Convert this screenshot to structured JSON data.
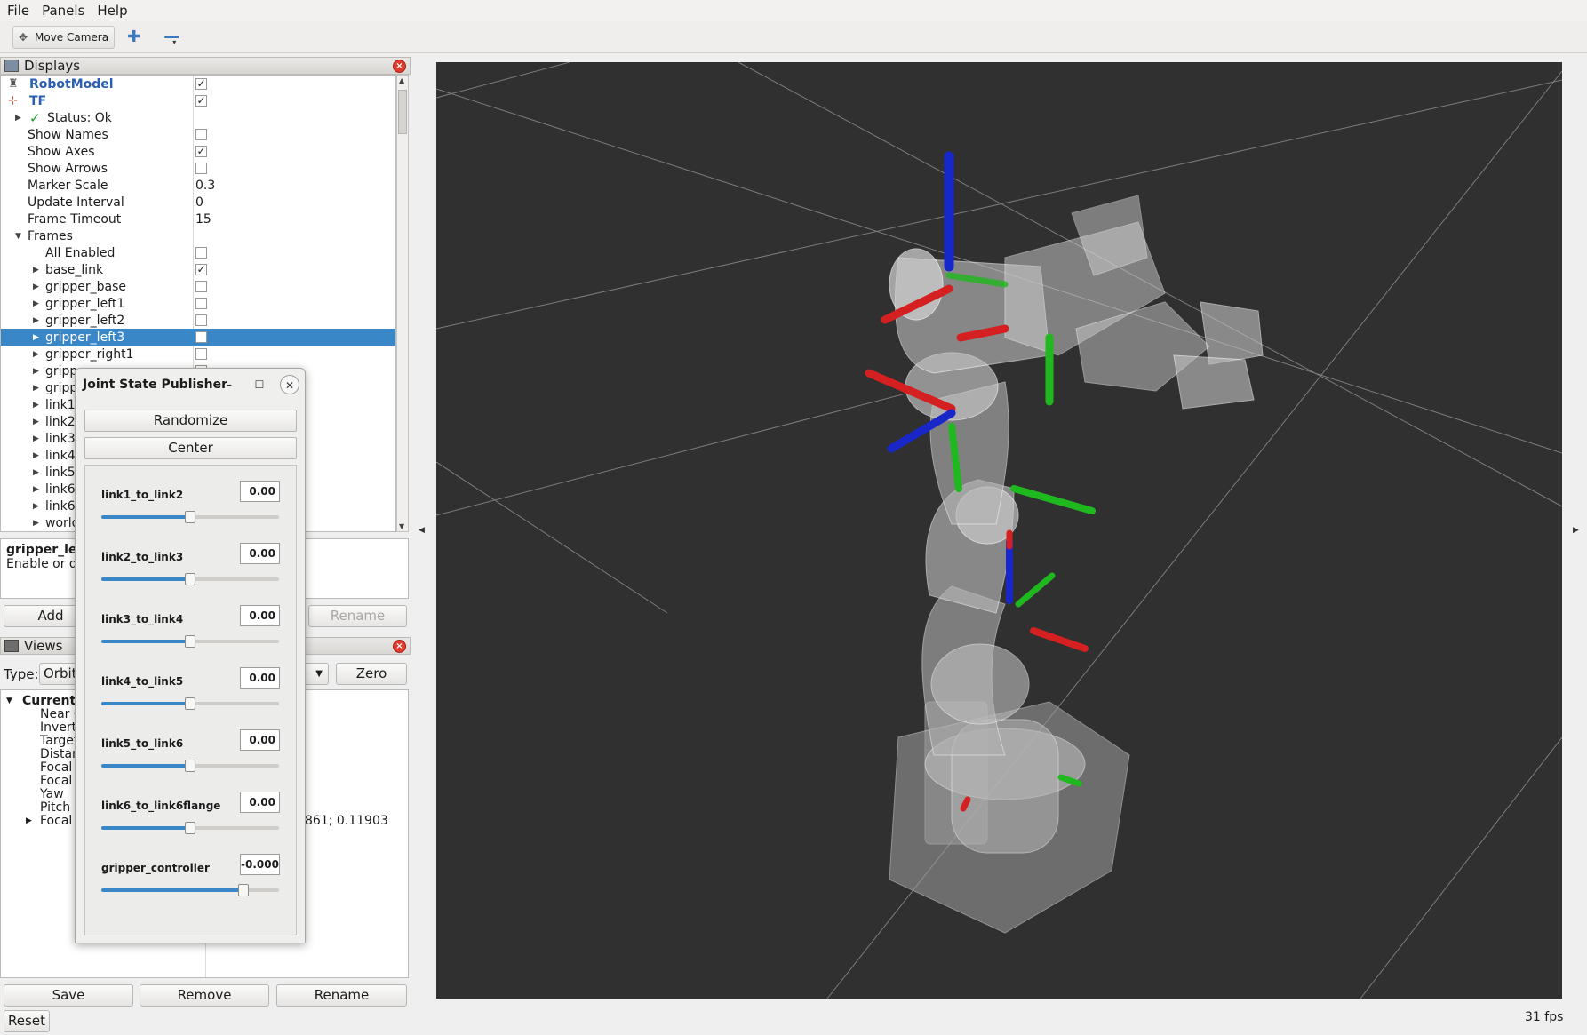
{
  "menu": {
    "file": "File",
    "panels": "Panels",
    "help": "Help"
  },
  "toolbar": {
    "move_camera": "Move Camera"
  },
  "displays_panel": {
    "title": "Displays",
    "tree": [
      {
        "label": "RobotModel",
        "checked": "✓",
        "kind": "display"
      },
      {
        "label": "TF",
        "checked": "✓",
        "kind": "display"
      },
      {
        "label": "Status: Ok",
        "kind": "status"
      },
      {
        "label": "Show Names",
        "checked": ""
      },
      {
        "label": "Show Axes",
        "checked": "✓"
      },
      {
        "label": "Show Arrows",
        "checked": ""
      },
      {
        "label": "Marker Scale",
        "value": "0.3"
      },
      {
        "label": "Update Interval",
        "value": "0"
      },
      {
        "label": "Frame Timeout",
        "value": "15"
      },
      {
        "label": "Frames"
      },
      {
        "label": "All Enabled",
        "checked": ""
      },
      {
        "label": "base_link",
        "checked": "✓"
      },
      {
        "label": "gripper_base",
        "checked": ""
      },
      {
        "label": "gripper_left1",
        "checked": ""
      },
      {
        "label": "gripper_left2",
        "checked": ""
      },
      {
        "label": "gripper_left3",
        "checked": "",
        "selected": true
      },
      {
        "label": "gripper_right1",
        "checked": ""
      },
      {
        "label": "gripp",
        "checked": ""
      },
      {
        "label": "gripp"
      },
      {
        "label": "link1"
      },
      {
        "label": "link2"
      },
      {
        "label": "link3"
      },
      {
        "label": "link4"
      },
      {
        "label": "link5"
      },
      {
        "label": "link6"
      },
      {
        "label": "link6"
      },
      {
        "label": "world"
      }
    ],
    "description_title": "gripper_lef",
    "description_text": "Enable or di",
    "buttons": {
      "add": "Add",
      "rename": "Rename"
    }
  },
  "views_panel": {
    "title": "Views",
    "type_label": "Type:",
    "type_value": "Orbit",
    "zero": "Zero",
    "tree": [
      {
        "label": "Current"
      },
      {
        "label": "Near C"
      },
      {
        "label": "Invert"
      },
      {
        "label": "Target"
      },
      {
        "label": "Distan"
      },
      {
        "label": "Focal"
      },
      {
        "label": "Focal"
      },
      {
        "label": "Yaw"
      },
      {
        "label": "Pitch"
      },
      {
        "label": "Focal",
        "value": "861; 0.11903"
      }
    ],
    "buttons": {
      "save": "Save",
      "remove": "Remove",
      "rename": "Rename"
    },
    "reset": "Reset"
  },
  "status": {
    "fps": "31 fps"
  },
  "joint_state_publisher": {
    "title": "Joint State Publisher",
    "randomize": "Randomize",
    "center": "Center",
    "joints": [
      {
        "name": "link1_to_link2",
        "value": "0.00",
        "fraction": 0.5
      },
      {
        "name": "link2_to_link3",
        "value": "0.00",
        "fraction": 0.5
      },
      {
        "name": "link3_to_link4",
        "value": "0.00",
        "fraction": 0.5
      },
      {
        "name": "link4_to_link5",
        "value": "0.00",
        "fraction": 0.5
      },
      {
        "name": "link5_to_link6",
        "value": "0.00",
        "fraction": 0.5
      },
      {
        "name": "link6_to_link6flange",
        "value": "0.00",
        "fraction": 0.5
      },
      {
        "name": "gripper_controller",
        "value": "-0.000",
        "fraction": 0.8
      }
    ]
  },
  "colors": {
    "selection": "#3a87c8",
    "viewport_bg": "#303030",
    "axis_x": "#d42020",
    "axis_y": "#1fb81f",
    "axis_z": "#1a27c8"
  }
}
